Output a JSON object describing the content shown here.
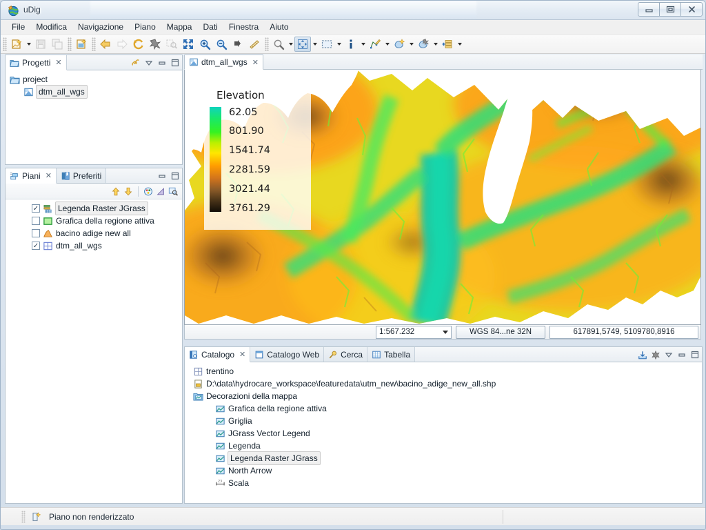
{
  "window": {
    "title": "uDig",
    "app_icon": "globe-icon",
    "buttons": {
      "minimize": "minimize-icon",
      "maximize": "maximize-icon",
      "close": "close-icon"
    }
  },
  "menubar": {
    "items": [
      {
        "label": "File"
      },
      {
        "label": "Modifica"
      },
      {
        "label": "Navigazione"
      },
      {
        "label": "Piano"
      },
      {
        "label": "Mappa"
      },
      {
        "label": "Dati"
      },
      {
        "label": "Finestra"
      },
      {
        "label": "Aiuto"
      }
    ]
  },
  "toolbar": {
    "groups": [
      {
        "items": [
          {
            "icon": "new-map-icon",
            "dropdown": true,
            "enabled": true
          },
          {
            "icon": "save-icon",
            "enabled": false
          },
          {
            "icon": "save-all-icon",
            "enabled": false
          }
        ]
      },
      {
        "items": [
          {
            "icon": "new-page-icon",
            "enabled": true
          }
        ]
      },
      {
        "items": [
          {
            "icon": "back-arrow-icon",
            "enabled": true
          },
          {
            "icon": "forward-arrow-icon",
            "enabled": false
          },
          {
            "icon": "refresh-icon",
            "enabled": true
          },
          {
            "icon": "stop-render-icon",
            "enabled": true
          },
          {
            "icon": "zoom-selection-icon",
            "enabled": false
          },
          {
            "icon": "zoom-extent-icon",
            "enabled": true
          },
          {
            "icon": "zoom-in-icon",
            "enabled": true
          },
          {
            "icon": "zoom-out-icon",
            "enabled": true
          },
          {
            "icon": "pan-next-icon",
            "enabled": true
          },
          {
            "icon": "ruler-icon",
            "enabled": true
          }
        ]
      },
      {
        "items": [
          {
            "icon": "zoom-tool-icon",
            "dropdown": true,
            "enabled": true
          },
          {
            "icon": "pan-tool-icon",
            "dropdown": true,
            "enabled": true,
            "active": true
          },
          {
            "icon": "select-box-icon",
            "dropdown": true,
            "enabled": true
          },
          {
            "icon": "info-tool-icon",
            "dropdown": true,
            "enabled": true
          },
          {
            "icon": "edit-geometry-icon",
            "dropdown": true,
            "enabled": true
          },
          {
            "icon": "add-feature-icon",
            "dropdown": true,
            "enabled": true
          },
          {
            "icon": "delete-feature-icon",
            "dropdown": true,
            "enabled": true
          },
          {
            "icon": "layer-stack-icon",
            "dropdown": true,
            "enabled": true
          }
        ]
      }
    ]
  },
  "projects_view": {
    "tab": {
      "label": "Progetti",
      "icon": "projects-icon",
      "closable": true
    },
    "controls": [
      "link-icon",
      "view-menu-icon",
      "minimize-view-icon",
      "maximize-view-icon"
    ],
    "tree": [
      {
        "label": "project",
        "icon": "folder-project-icon",
        "indent": 0,
        "selected": false
      },
      {
        "label": "dtm_all_wgs",
        "icon": "map-icon",
        "indent": 1,
        "selected": true
      }
    ]
  },
  "layers_view": {
    "tabs": [
      {
        "label": "Piani",
        "icon": "layers-icon",
        "selected": true,
        "closable": true
      },
      {
        "label": "Preferiti",
        "icon": "bookmarks-icon",
        "selected": false,
        "closable": false
      }
    ],
    "controls": [
      "minimize-view-icon",
      "maximize-view-icon"
    ],
    "toolbar": [
      "move-up-icon",
      "move-down-icon",
      "style-icon",
      "transparency-icon",
      "zoom-to-layer-icon"
    ],
    "layers": [
      {
        "label": "Legenda Raster JGrass",
        "checked": true,
        "icon": "raster-legend-icon",
        "selected": true
      },
      {
        "label": "Grafica della regione attiva",
        "checked": false,
        "icon": "green-square-icon",
        "selected": false
      },
      {
        "label": "bacino adige new all",
        "checked": false,
        "icon": "polygon-icon",
        "selected": false
      },
      {
        "label": "dtm_all_wgs",
        "checked": true,
        "icon": "grid-icon",
        "selected": false
      }
    ]
  },
  "editor": {
    "tab": {
      "label": "dtm_all_wgs",
      "icon": "map-icon",
      "closable": true
    },
    "status": {
      "scale": "1:567.232",
      "crs": "WGS 84...ne 32N",
      "coordinates": "617891,5749, 5109780,8916"
    }
  },
  "map_legend": {
    "title": "Elevation",
    "values": [
      "62.05",
      "801.90",
      "1541.74",
      "2281.59",
      "3021.44",
      "3761.29"
    ],
    "ramp_colors": [
      "#0fd3bd",
      "#18e86a",
      "#35f221",
      "#b9f000",
      "#ffe600",
      "#ff9d00",
      "#d2741c",
      "#8a5a28",
      "#4a3418",
      "#120d07"
    ]
  },
  "catalog_view": {
    "tabs": [
      {
        "label": "Catalogo",
        "icon": "catalog-icon",
        "selected": true,
        "closable": true
      },
      {
        "label": "Catalogo Web",
        "icon": "web-catalog-icon",
        "selected": false,
        "closable": false
      },
      {
        "label": "Cerca",
        "icon": "search-icon",
        "selected": false,
        "closable": false
      },
      {
        "label": "Tabella",
        "icon": "table-icon",
        "selected": false,
        "closable": false
      }
    ],
    "controls": [
      "import-icon",
      "remove-icon",
      "view-menu-icon",
      "minimize-view-icon",
      "maximize-view-icon"
    ],
    "items": [
      {
        "label": "trentino",
        "icon": "grid-icon",
        "indent": 0,
        "selected": false
      },
      {
        "label": "D:\\data\\hydrocare_workspace\\featuredata\\utm_new\\bacino_adige_new_all.shp",
        "icon": "shapefile-icon",
        "indent": 0,
        "selected": false
      },
      {
        "label": "Decorazioni della mappa",
        "icon": "decorations-folder-icon",
        "indent": 0,
        "selected": false
      },
      {
        "label": "Grafica della regione attiva",
        "icon": "decoration-icon",
        "indent": 1,
        "selected": false
      },
      {
        "label": "Griglia",
        "icon": "decoration-icon",
        "indent": 1,
        "selected": false
      },
      {
        "label": "JGrass Vector Legend",
        "icon": "decoration-icon",
        "indent": 1,
        "selected": false
      },
      {
        "label": "Legenda",
        "icon": "decoration-icon",
        "indent": 1,
        "selected": false
      },
      {
        "label": "Legenda Raster JGrass",
        "icon": "decoration-icon",
        "indent": 1,
        "selected": true
      },
      {
        "label": "North Arrow",
        "icon": "decoration-icon",
        "indent": 1,
        "selected": false
      },
      {
        "label": "Scala",
        "icon": "scale-bar-icon",
        "indent": 1,
        "selected": false
      }
    ]
  },
  "statusbar": {
    "icon": "render-status-icon",
    "text": "Piano non renderizzato"
  },
  "colors": {
    "accent": "#f0a800",
    "selection": "#cfe3f7",
    "window_bg": "#d4dfeb",
    "panel_border": "#b6c3ce"
  }
}
